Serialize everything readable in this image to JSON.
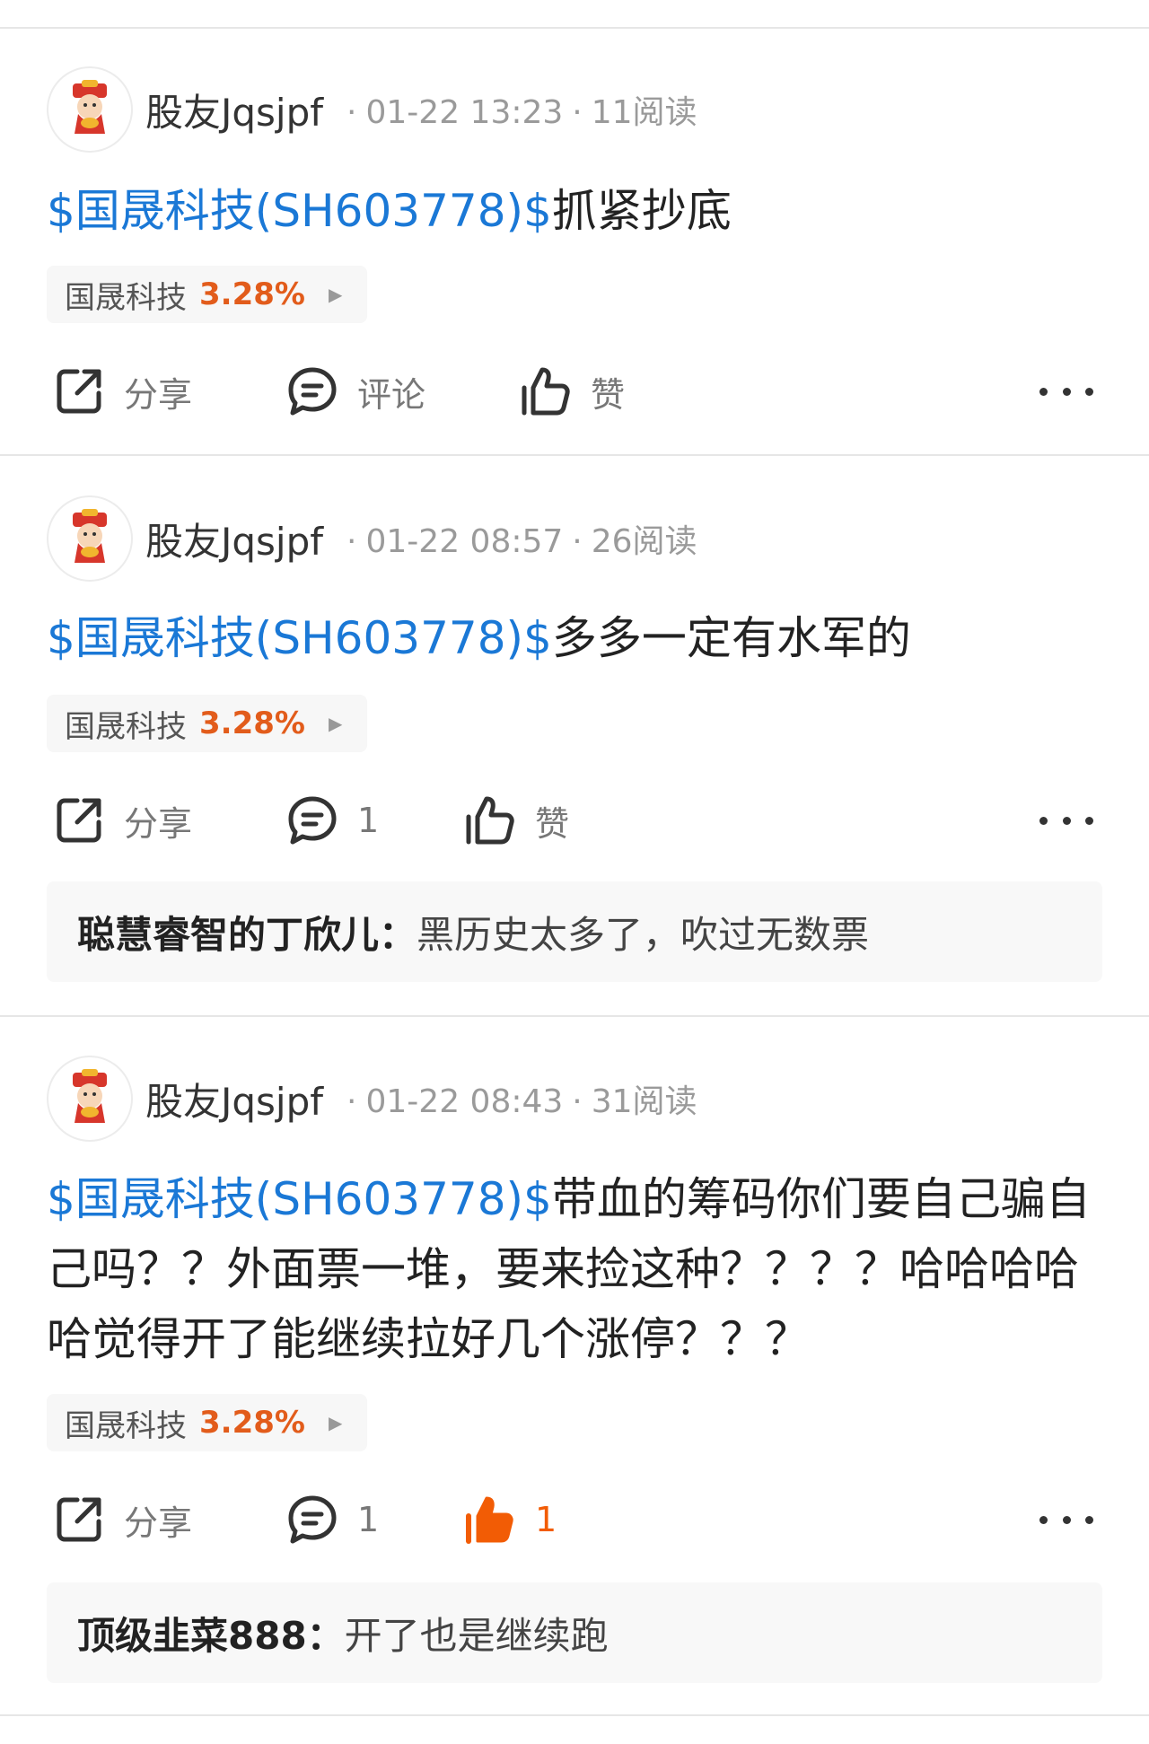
{
  "posts": [
    {
      "author": "股友Jqsjpf",
      "time": "01-22 13:23",
      "reads": "11阅读",
      "stock_link": "$国晟科技(SH603778)$",
      "text": "抓紧抄底",
      "chip": {
        "name": "国晟科技",
        "change": "3.28%"
      },
      "share_label": "分享",
      "comment_label": "评论",
      "like_label": "赞",
      "comment": null
    },
    {
      "author": "股友Jqsjpf",
      "time": "01-22 08:57",
      "reads": "26阅读",
      "stock_link": "$国晟科技(SH603778)$",
      "text": "多多一定有水军的",
      "chip": {
        "name": "国晟科技",
        "change": "3.28%"
      },
      "share_label": "分享",
      "comment_label": "1",
      "like_label": "赞",
      "comment": {
        "name": "聪慧睿智的丁欣儿：",
        "text": "黑历史太多了，吹过无数票"
      }
    },
    {
      "author": "股友Jqsjpf",
      "time": "01-22 08:43",
      "reads": "31阅读",
      "stock_link": "$国晟科技(SH603778)$",
      "text": "带血的筹码你们要自己骗自己吗？？外面票一堆，要来捡这种？？？？哈哈哈哈哈觉得开了能继续拉好几个涨停？？？",
      "chip": {
        "name": "国晟科技",
        "change": "3.28%"
      },
      "share_label": "分享",
      "comment_label": "1",
      "like_label": "1",
      "comment": {
        "name": "顶级韭菜888：",
        "text": "开了也是继续跑"
      }
    }
  ],
  "meta_separator": "·",
  "colors": {
    "link": "#1a78d6",
    "up": "#e25c1b",
    "liked": "#f25c05"
  },
  "icons": [
    "avatar-caishen-icon",
    "share-icon",
    "comment-icon",
    "thumbs-up-icon",
    "more-icon",
    "chevron-right-icon"
  ]
}
